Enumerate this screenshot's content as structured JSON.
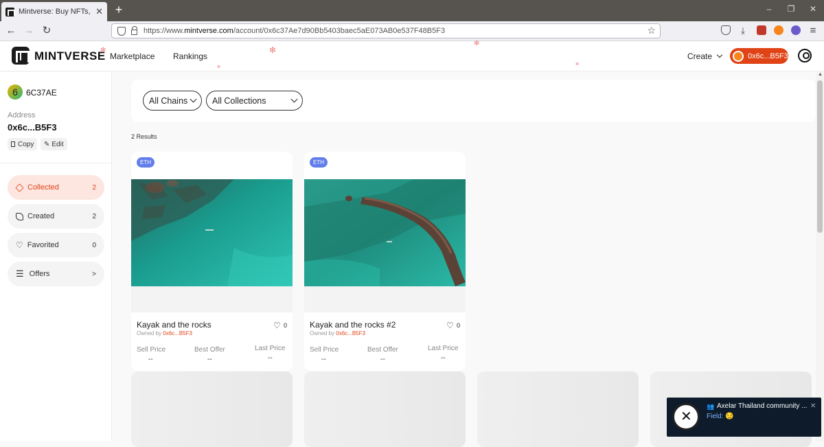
{
  "browser": {
    "tab_title": "Mintverse: Buy NFTs, gaming ite",
    "tab_close": "✕",
    "new_tab": "+",
    "url_host": "https://www.",
    "url_domain": "mintverse.com",
    "url_path": "/account/0x6c37Ae7d90Bb5403baec5aE073AB0e537F48B5F3",
    "win_min": "–",
    "win_max": "❐",
    "win_close": "✕"
  },
  "header": {
    "logo": "MINTVERSE",
    "nav": [
      "Marketplace",
      "Rankings"
    ],
    "create": "Create",
    "wallet": "0x6c...B5F3"
  },
  "sidebar": {
    "avatar_char": "6",
    "account_name": "6C37AE",
    "address_label": "Address",
    "address_value": "0x6c...B5F3",
    "copy": "Copy",
    "edit": "Edit",
    "items": [
      {
        "label": "Collected",
        "count": "2"
      },
      {
        "label": "Created",
        "count": "2"
      },
      {
        "label": "Favorited",
        "count": "0"
      },
      {
        "label": "Offers",
        "count": ">"
      }
    ]
  },
  "filters": {
    "chains": "All Chains",
    "collections": "All Collections"
  },
  "results_text": "2 Results",
  "cards": [
    {
      "chain": "ETH",
      "name": "Kayak and the rocks",
      "likes": "0",
      "owner_prefix": "Owned by ",
      "owner": "0x6c...B5F3",
      "sell_label": "Sell Price",
      "sell_value": "--",
      "offer_label": "Best Offer",
      "offer_value": "--",
      "last_label": "Last Price",
      "last_value": "--"
    },
    {
      "chain": "ETH",
      "name": "Kayak and the rocks #2",
      "likes": "0",
      "owner_prefix": "Owned by ",
      "owner": "0x6c...B5F3",
      "sell_label": "Sell Price",
      "sell_value": "--",
      "offer_label": "Best Offer",
      "offer_value": "--",
      "last_label": "Last Price",
      "last_value": "--"
    }
  ],
  "toast": {
    "title": "Axelar Thailand community ...",
    "field_label": "Field:",
    "field_value": "😏",
    "close": "✕"
  },
  "colors": {
    "accent": "#e04316",
    "eth_badge": "#627eea",
    "active_bg": "#fde5e0"
  }
}
